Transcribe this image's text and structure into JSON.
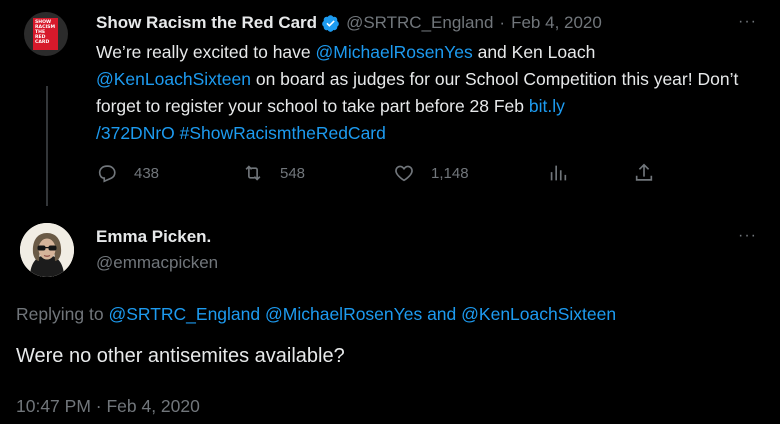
{
  "parent": {
    "avatar_text": [
      "SHOW",
      "RACISM",
      "THE",
      "RED",
      "CARD"
    ],
    "name": "Show Racism the Red Card",
    "handle": "@SRTRC_England",
    "dot": "·",
    "date": "Feb 4, 2020",
    "more": "···",
    "text": {
      "t1": "We’re really excited to have ",
      "m1": "@MichaelRosenYes",
      "t2": " and Ken Loach",
      "m2": "@KenLoachSixteen",
      "t3": " on board as judges for our School Competition this year! Don’t forget to register your school to take part before 28 Feb ",
      "link1": "bit.ly",
      "link2": "/372DNrO",
      "hashtag": "#ShowRacismtheRedCard"
    },
    "actions": {
      "replies": "438",
      "retweets": "548",
      "likes": "1,148"
    }
  },
  "reply": {
    "name": "Emma Picken.",
    "handle": "@emmacpicken",
    "more": "···",
    "replying_label": "Replying to",
    "replying_to_1": "@SRTRC_England",
    "replying_to_2": "@MichaelRosenYes",
    "replying_and": "and",
    "replying_to_3": "@KenLoachSixteen",
    "text": "Were no other antisemites available?",
    "timestamp": "10:47 PM · Feb 4, 2020"
  },
  "colors": {
    "background": "#000000",
    "text": "#e7e9ea",
    "muted": "#71767b",
    "link": "#1d9bf0",
    "brand_red": "#d7192b"
  },
  "icons": [
    "reply-icon",
    "retweet-icon",
    "like-icon",
    "views-icon",
    "share-icon",
    "verified-icon",
    "more-icon"
  ]
}
